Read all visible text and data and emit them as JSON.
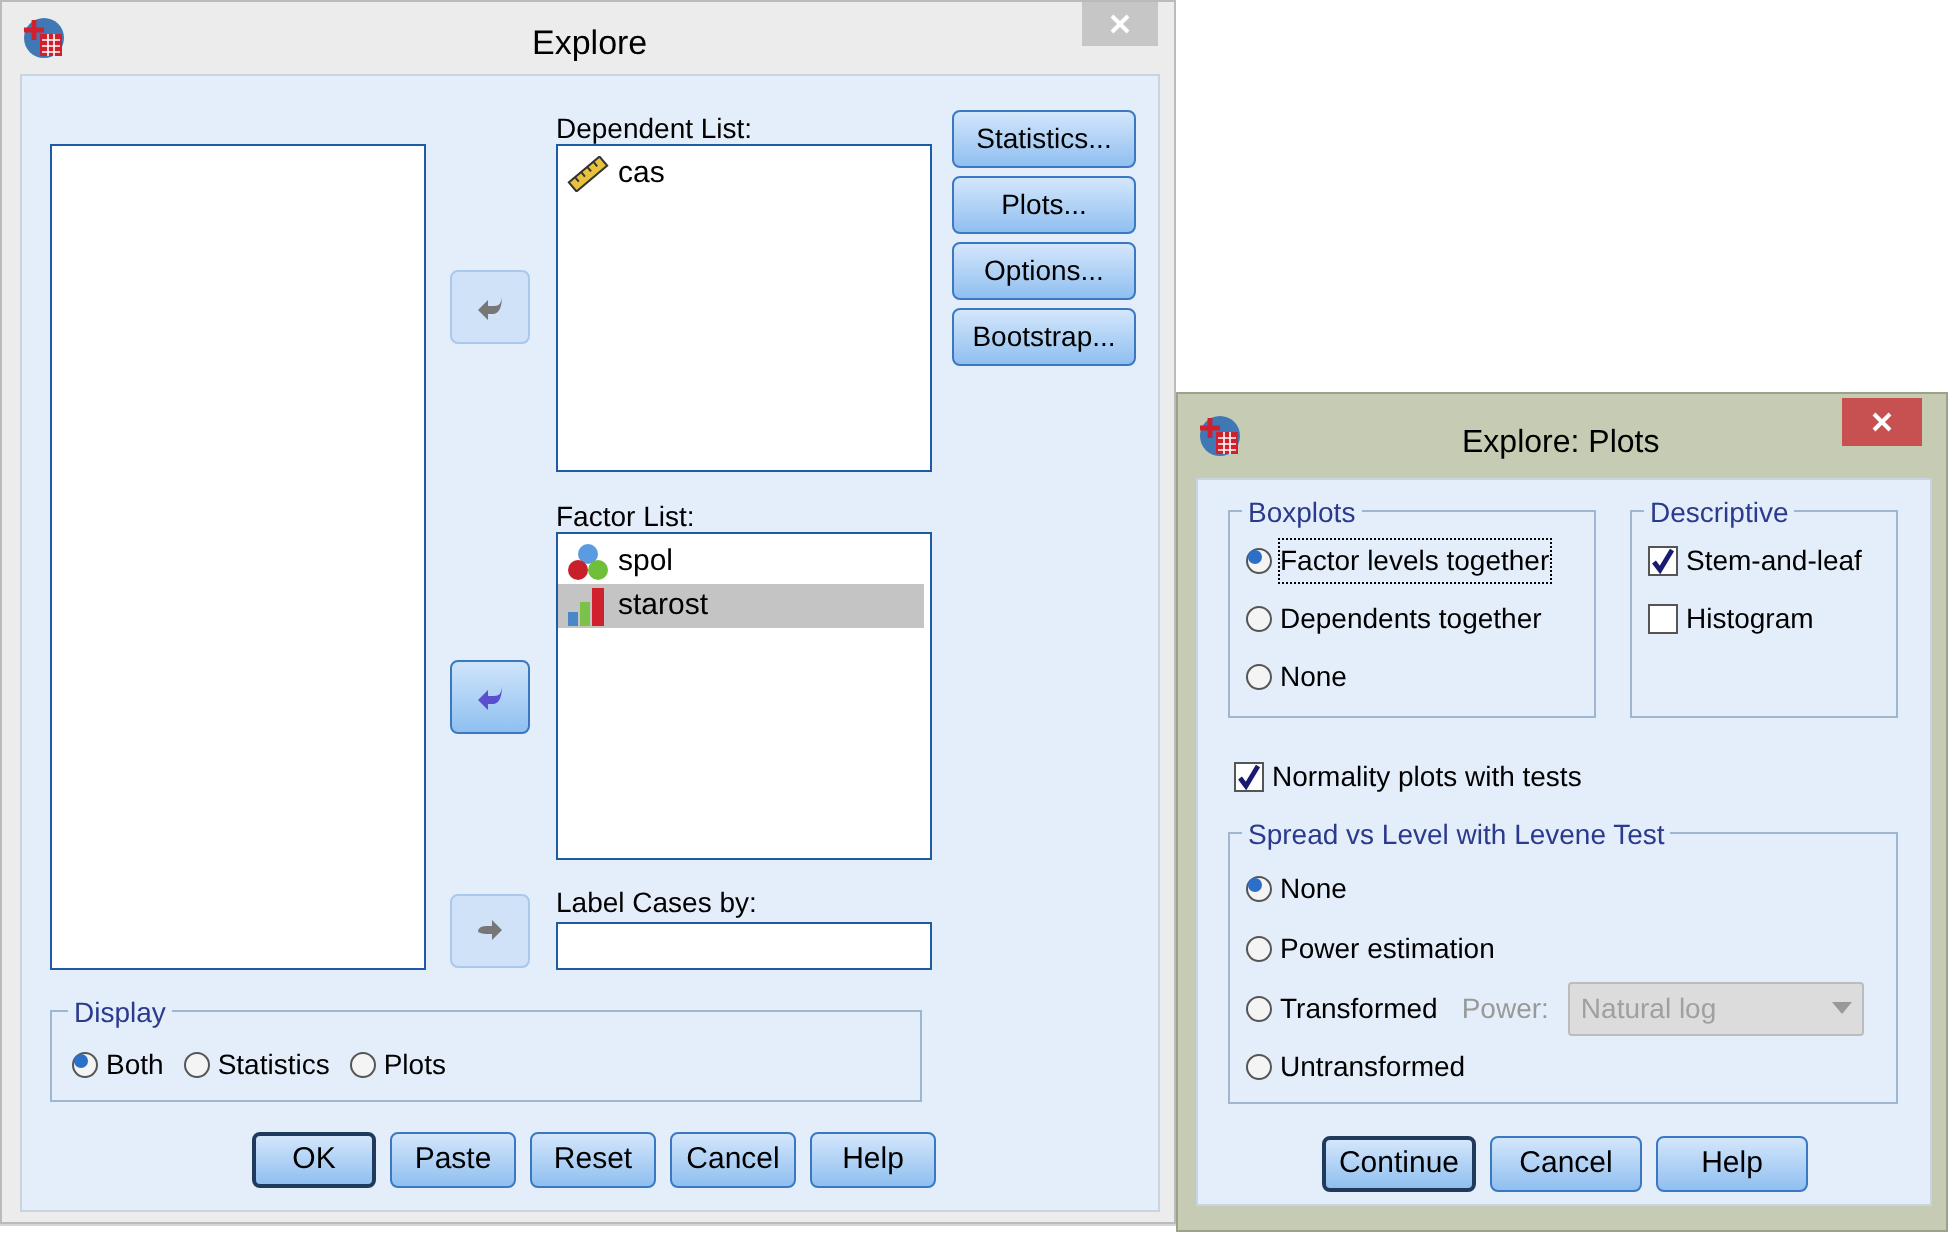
{
  "explore": {
    "title": "Explore",
    "dependent_list": {
      "label": "Dependent List:",
      "items": [
        {
          "name": "cas",
          "kind": "scale",
          "selected": false
        }
      ]
    },
    "factor_list": {
      "label": "Factor List:",
      "items": [
        {
          "name": "spol",
          "kind": "nominal",
          "selected": false
        },
        {
          "name": "starost",
          "kind": "ordinal",
          "selected": true
        }
      ]
    },
    "label_cases": {
      "label": "Label Cases by:"
    },
    "arrow_buttons": [
      {
        "kind": "left",
        "disabled": true
      },
      {
        "kind": "left",
        "disabled": false
      },
      {
        "kind": "right",
        "disabled": true
      }
    ],
    "side_buttons": [
      "Statistics...",
      "Plots...",
      "Options...",
      "Bootstrap..."
    ],
    "display": {
      "title": "Display",
      "options": [
        {
          "label": "Both",
          "selected": true
        },
        {
          "label": "Statistics",
          "selected": false
        },
        {
          "label": "Plots",
          "selected": false
        }
      ]
    },
    "buttons": [
      {
        "label": "OK",
        "default": true
      },
      {
        "label": "Paste",
        "default": false
      },
      {
        "label": "Reset",
        "default": false
      },
      {
        "label": "Cancel",
        "default": false
      },
      {
        "label": "Help",
        "default": false
      }
    ]
  },
  "plots": {
    "title": "Explore: Plots",
    "boxplots": {
      "title": "Boxplots",
      "options": [
        {
          "label": "Factor levels together",
          "selected": true
        },
        {
          "label": "Dependents together",
          "selected": false
        },
        {
          "label": "None",
          "selected": false
        }
      ]
    },
    "descriptive": {
      "title": "Descriptive",
      "options": [
        {
          "label": "Stem-and-leaf",
          "checked": true
        },
        {
          "label": "Histogram",
          "checked": false
        }
      ]
    },
    "normality": {
      "label": "Normality plots with tests",
      "checked": true
    },
    "spread": {
      "title": "Spread vs Level with Levene Test",
      "options": [
        {
          "label": "None",
          "selected": true
        },
        {
          "label": "Power estimation",
          "selected": false
        },
        {
          "label": "Transformed",
          "selected": false
        },
        {
          "label": "Untransformed",
          "selected": false
        }
      ]
    },
    "power": {
      "label": "Power:",
      "value": "Natural log",
      "disabled": true
    },
    "buttons": [
      {
        "label": "Continue",
        "default": true
      },
      {
        "label": "Cancel",
        "default": false
      },
      {
        "label": "Help",
        "default": false
      }
    ]
  }
}
